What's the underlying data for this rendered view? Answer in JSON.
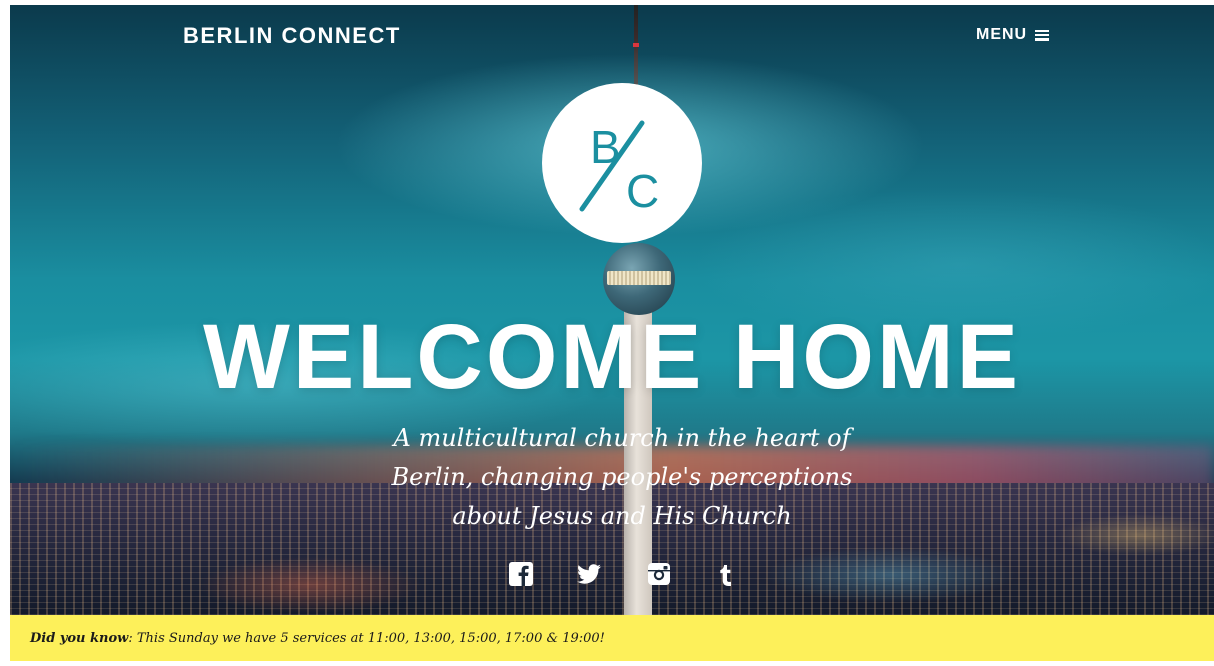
{
  "header": {
    "brand": "BERLIN CONNECT",
    "menu_label": "MENU"
  },
  "logo": {
    "top_letter": "B",
    "bottom_letter": "C",
    "accent_color": "#1b8fa0"
  },
  "hero": {
    "title": "WELCOME HOME",
    "tagline": "A multicultural church in the heart of Berlin, changing people's perceptions about Jesus and His Church"
  },
  "social": [
    {
      "name": "facebook"
    },
    {
      "name": "twitter"
    },
    {
      "name": "instagram"
    },
    {
      "name": "tumblr"
    }
  ],
  "notice": {
    "label": "Did you know",
    "separator": ":",
    "text": " This Sunday we have 5 services at 11:00, 13:00, 15:00, 17:00 & 19:00!",
    "background": "#fdf05a"
  }
}
